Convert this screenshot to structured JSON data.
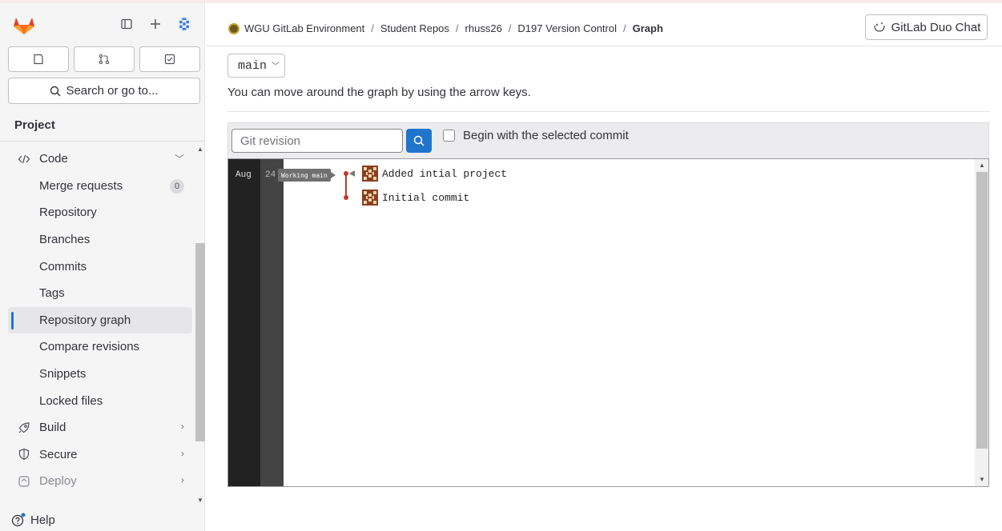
{
  "sidebar": {
    "search_label": "Search or go to...",
    "section_title": "Project",
    "code_label": "Code",
    "items": [
      {
        "label": "Merge requests",
        "badge": "0"
      },
      {
        "label": "Repository"
      },
      {
        "label": "Branches"
      },
      {
        "label": "Commits"
      },
      {
        "label": "Tags"
      },
      {
        "label": "Repository graph",
        "active": true
      },
      {
        "label": "Compare revisions"
      },
      {
        "label": "Snippets"
      },
      {
        "label": "Locked files"
      }
    ],
    "build_label": "Build",
    "secure_label": "Secure",
    "deploy_label": "Deploy",
    "help_label": "Help"
  },
  "header": {
    "breadcrumbs": [
      "WGU GitLab Environment",
      "Student Repos",
      "rhuss26",
      "D197 Version Control",
      "Graph"
    ],
    "duo_chat_label": "GitLab Duo Chat"
  },
  "main": {
    "branch": "main",
    "hint": "You can move around the graph by using the arrow keys.",
    "revision_placeholder": "Git revision",
    "begin_label": "Begin with the selected commit"
  },
  "graph": {
    "month": "Aug",
    "day": "24",
    "ref_label": "Working main",
    "commits": [
      {
        "message": "Added intial project"
      },
      {
        "message": "Initial commit"
      }
    ]
  },
  "colors": {
    "accent": "#1f75cb",
    "graph_line": "#c0392b"
  }
}
